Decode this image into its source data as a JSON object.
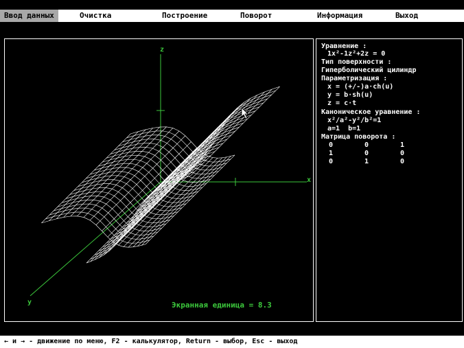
{
  "menu": {
    "items": [
      {
        "label": "Ввод данных",
        "active": true
      },
      {
        "label": "Очистка",
        "active": false
      },
      {
        "label": "Построение",
        "active": false
      },
      {
        "label": "Поворот",
        "active": false
      },
      {
        "label": "Информация",
        "active": false
      },
      {
        "label": "Выход",
        "active": false
      }
    ]
  },
  "plot": {
    "axis_labels": {
      "z": "z",
      "x": "x",
      "y": "y"
    },
    "scale_text": "Экранная единица = 8.3",
    "axis_color": "#3cc83c",
    "mesh_color": "#ffffff"
  },
  "info": {
    "equation_title": "Уравнение :",
    "equation": "1x²-1z²+2z = 0",
    "surface_type_title": "Тип поверхности :",
    "surface_type": "Гиперболический цилиндр",
    "parametrization_title": "Параметризация :",
    "param_x": "x = (+/-)a·ch(u)",
    "param_y": "y = b·sh(u)",
    "param_z": "z = c·t",
    "canonical_title": "Каноническое уравнение :",
    "canonical": "x²/a²-y²/b²=1",
    "coefficients": "a=1  b=1",
    "rotation_title": "Матрица поворота :",
    "rotation_matrix": [
      [
        "0",
        "0",
        "1"
      ],
      [
        "1",
        "0",
        "0"
      ],
      [
        "0",
        "1",
        "0"
      ]
    ]
  },
  "statusbar": {
    "text": "← и → - движение по меню, F2 - калькулятор, Return - выбор, Esc - выход"
  }
}
